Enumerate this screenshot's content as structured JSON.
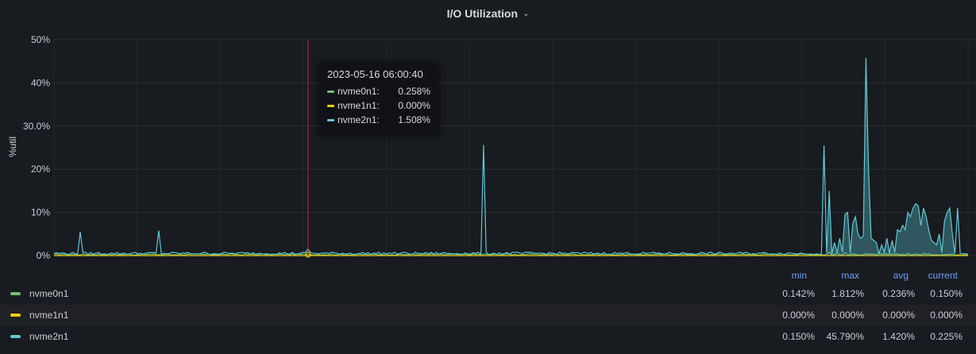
{
  "panel": {
    "title": "I/O Utilization",
    "chevron": "⌄"
  },
  "chart_data": {
    "type": "area",
    "ylabel": "%util",
    "ylim": [
      0,
      50
    ],
    "yticks": [
      "0%",
      "10%",
      "20%",
      "30.0%",
      "40%",
      "50%"
    ],
    "grid": true,
    "x_count": 350,
    "series": [
      {
        "name": "nvme0n1",
        "color": "#73bf69",
        "spikes": [
          [
            296,
            0.8
          ],
          [
            299,
            0.6
          ],
          [
            302,
            0.7
          ],
          [
            310,
            0.5
          ],
          [
            315,
            0.6
          ],
          [
            320,
            0.4
          ],
          [
            326,
            0.5
          ],
          [
            332,
            0.5
          ]
        ],
        "base": 0.2
      },
      {
        "name": "nvme1n1",
        "color": "#f2cc0c",
        "spikes": [],
        "base": 0.0
      },
      {
        "name": "nvme2n1",
        "color": "#5fc8d6",
        "base": 0.4,
        "spikes": [
          [
            10,
            5.5
          ],
          [
            40,
            5.8
          ],
          [
            97,
            1.5
          ],
          [
            164,
            25.6
          ],
          [
            294,
            25.5
          ],
          [
            296,
            15
          ],
          [
            298,
            3
          ],
          [
            300,
            4
          ],
          [
            302,
            9.5
          ],
          [
            303,
            10
          ],
          [
            305,
            7.5
          ],
          [
            306,
            9
          ],
          [
            307,
            5
          ],
          [
            308,
            4
          ],
          [
            309,
            4.5
          ],
          [
            310,
            45.8
          ],
          [
            311,
            20
          ],
          [
            312,
            4
          ],
          [
            313,
            3.5
          ],
          [
            314,
            3
          ],
          [
            316,
            2.5
          ],
          [
            318,
            4
          ],
          [
            320,
            3.5
          ],
          [
            322,
            6
          ],
          [
            323,
            5.5
          ],
          [
            324,
            7
          ],
          [
            325,
            6
          ],
          [
            326,
            10
          ],
          [
            327,
            9
          ],
          [
            328,
            11
          ],
          [
            329,
            12
          ],
          [
            330,
            11.5
          ],
          [
            331,
            7
          ],
          [
            332,
            11
          ],
          [
            333,
            9
          ],
          [
            334,
            6
          ],
          [
            335,
            3.5
          ],
          [
            336,
            3
          ],
          [
            337,
            2.5
          ],
          [
            338,
            5
          ],
          [
            340,
            8
          ],
          [
            341,
            10
          ],
          [
            342,
            11
          ],
          [
            343,
            5
          ],
          [
            344,
            0.5
          ],
          [
            345,
            11
          ],
          [
            346,
            0.5
          ]
        ],
        "fill_range": [
          295,
          344
        ]
      }
    ]
  },
  "cursor": {
    "time": "2023-05-16 06:00:40",
    "index": 97
  },
  "tooltip": {
    "time": "2023-05-16 06:00:40",
    "rows": [
      {
        "name": "nvme0n1:",
        "value": "0.258%",
        "color": "#73bf69"
      },
      {
        "name": "nvme1n1:",
        "value": "0.000%",
        "color": "#f2cc0c"
      },
      {
        "name": "nvme2n1:",
        "value": "1.508%",
        "color": "#5fc8d6"
      }
    ]
  },
  "legend": {
    "headers": [
      "min",
      "max",
      "avg",
      "current"
    ],
    "rows": [
      {
        "name": "nvme0n1",
        "color": "#73bf69",
        "min": "0.142%",
        "max": "1.812%",
        "avg": "0.236%",
        "current": "0.150%"
      },
      {
        "name": "nvme1n1",
        "color": "#f2cc0c",
        "min": "0.000%",
        "max": "0.000%",
        "avg": "0.000%",
        "current": "0.000%"
      },
      {
        "name": "nvme2n1",
        "color": "#5fc8d6",
        "min": "0.150%",
        "max": "45.790%",
        "avg": "1.420%",
        "current": "0.225%"
      }
    ]
  }
}
